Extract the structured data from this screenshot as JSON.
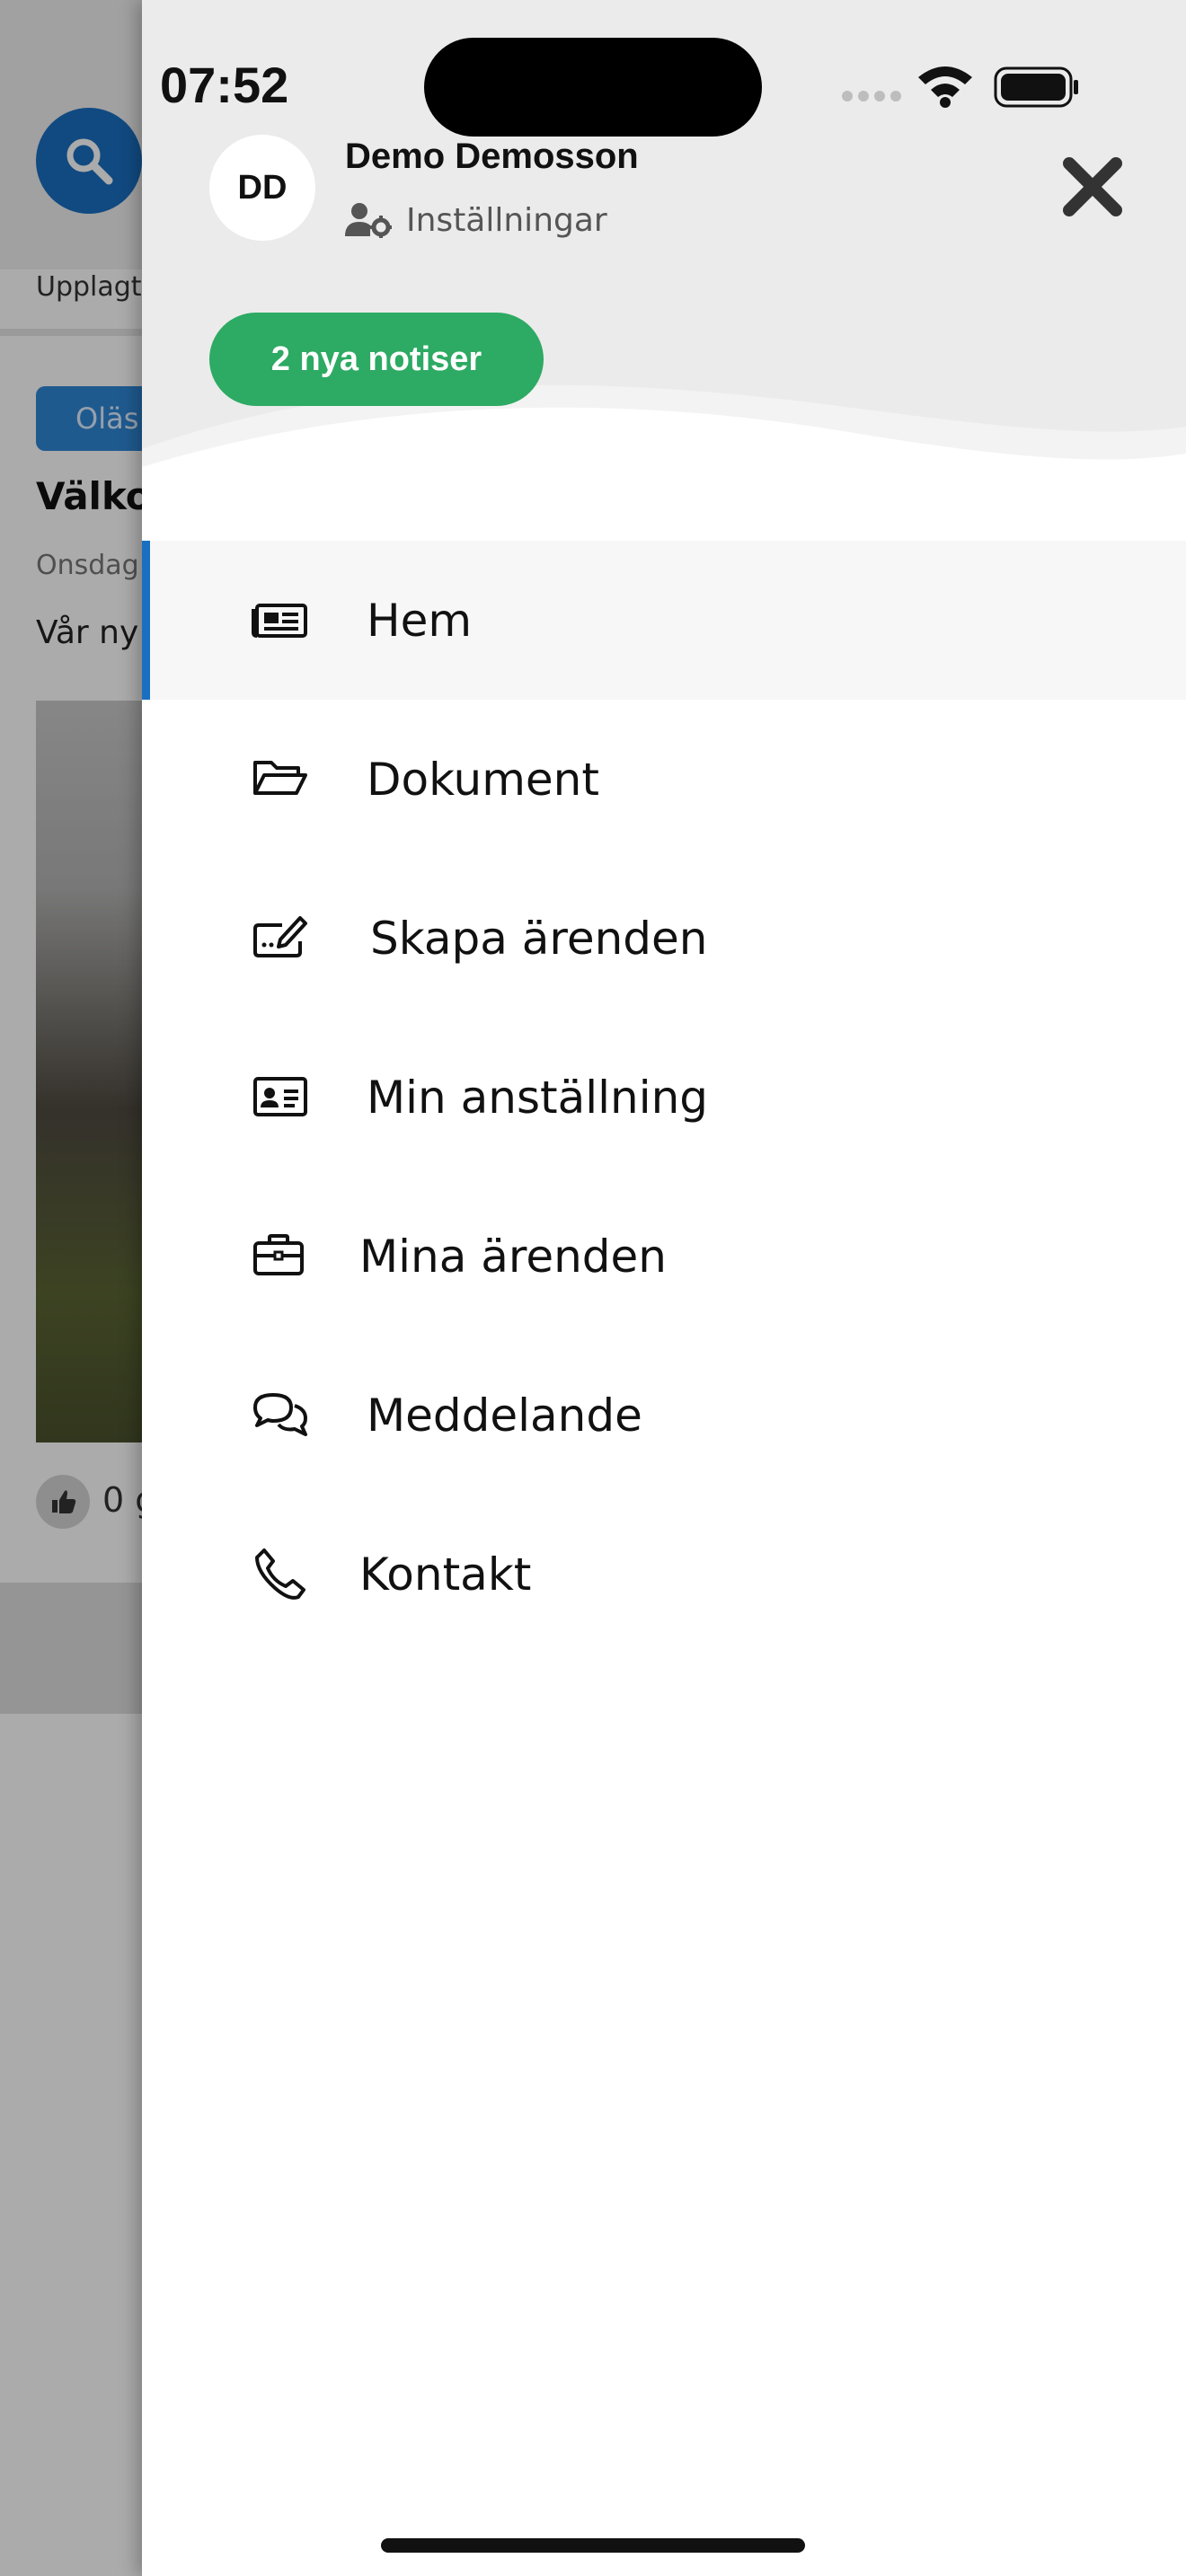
{
  "status_bar": {
    "time": "07:52"
  },
  "background": {
    "published_label": "Upplagt",
    "badge": "Oläs",
    "post_title": "Välko",
    "post_date": "Onsdag",
    "post_text": "Vår ny",
    "like_count": "0 g"
  },
  "drawer": {
    "user": {
      "initials": "DD",
      "name": "Demo Demosson"
    },
    "settings_label": "Inställningar",
    "notifications_label": "2 nya notiser",
    "menu": [
      {
        "label": "Hem",
        "icon": "newspaper-icon",
        "active": true
      },
      {
        "label": "Dokument",
        "icon": "folder-open-icon",
        "active": false
      },
      {
        "label": "Skapa ärenden",
        "icon": "create-case-icon",
        "active": false
      },
      {
        "label": "Min anställning",
        "icon": "id-card-icon",
        "active": false
      },
      {
        "label": "Mina ärenden",
        "icon": "briefcase-icon",
        "active": false
      },
      {
        "label": "Meddelande",
        "icon": "comments-icon",
        "active": false
      },
      {
        "label": "Kontakt",
        "icon": "phone-icon",
        "active": false
      }
    ]
  },
  "colors": {
    "accent_blue": "#1a6fc0",
    "notification_green": "#2daa63",
    "header_gray": "#ebebeb"
  }
}
